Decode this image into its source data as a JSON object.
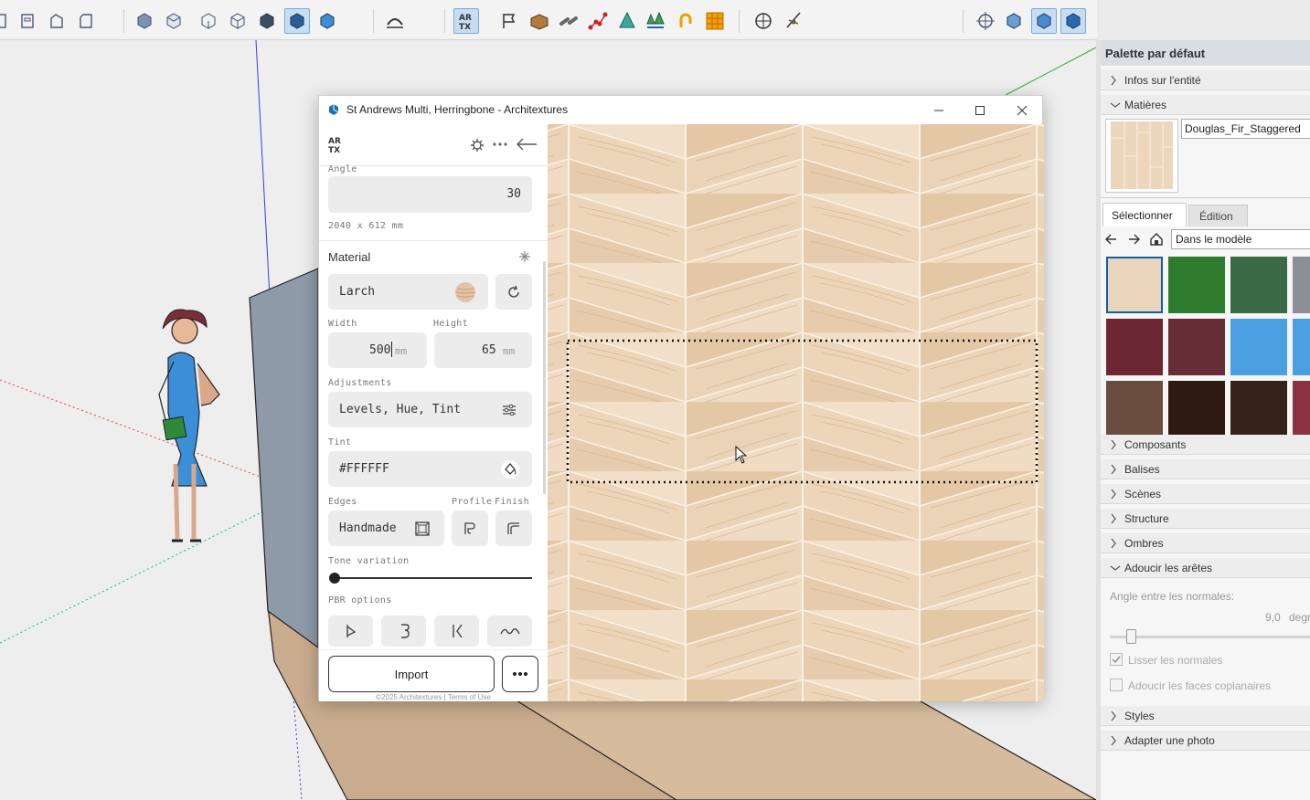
{
  "toolbar": {
    "icons": [
      "page-icon",
      "cabinet-icon",
      "house-outline-icon",
      "square-icon",
      "iso-view-icon",
      "top-view-icon",
      "front-view-icon",
      "right-view-icon",
      "back-view-icon",
      "left-view-icon",
      "wireframe-style-icon",
      "arc-sweep-icon",
      "architextures-icon",
      "flag-icon",
      "box-icon",
      "link-icon",
      "dots-path-icon",
      "cone-icon",
      "trees-icon",
      "gold-shape-icon",
      "grid-tile-icon",
      "target-icon",
      "pin-icon",
      "compass-icon",
      "cube-a-icon",
      "cube-b-icon",
      "cube-c-icon"
    ]
  },
  "dialog": {
    "title": "St Andrews Multi, Herringbone - Architextures",
    "logo": "AR TX",
    "angle_label": "Angle",
    "angle_value": "30",
    "size_text": "2040 x 612 mm",
    "material_title": "Material",
    "material_value": "Larch",
    "width_label": "Width",
    "height_label": "Height",
    "width_value": "500",
    "height_value": "65",
    "unit": "mm",
    "adjustments_label": "Adjustments",
    "adjustments_value": "Levels, Hue, Tint",
    "tint_label": "Tint",
    "tint_value": "#FFFFFF",
    "edges_label": "Edges",
    "profile_label": "Profile",
    "finish_label": "Finish",
    "edges_value": "Handmade",
    "tone_label": "Tone variation",
    "tone_value": 0,
    "pbr_label": "PBR options",
    "import_label": "Import",
    "footer": "©2025 Architextures | Terms of Use"
  },
  "tray": {
    "title": "Palette par défaut",
    "entity_info": "Infos sur l'entité",
    "materials": "Matières",
    "material_name": "Douglas_Fir_Staggered",
    "tab_select": "Sélectionner",
    "tab_edit": "Édition",
    "collection": "Dans le modèle",
    "swatches": [
      "#ead6bd",
      "#2e7d2e",
      "#3b6b45",
      "#8e8e96",
      "#6d2633",
      "#672d36",
      "#4a9fe0",
      "#4a9fe0",
      "#6a4d3f",
      "#2f1a12",
      "#342218",
      "#8a3240"
    ],
    "sections_a": [
      "Composants",
      "Balises",
      "Scènes",
      "Structure",
      "Ombres"
    ],
    "soften": "Adoucir les arêtes",
    "normals_label": "Angle entre les normales:",
    "normals_value": "9,0",
    "normals_unit": "degr",
    "smooth_normals": "Lisser les normales",
    "soften_coplanar": "Adoucir les faces coplanaires",
    "sections_b": [
      "Styles",
      "Adapter une photo"
    ]
  },
  "colors": {
    "accent": "#0f5fa8",
    "wood_light": "#efdcc6",
    "wood_dark": "#d8b896",
    "wall": "#8f9aa8",
    "floor": "#c9ab8e"
  }
}
